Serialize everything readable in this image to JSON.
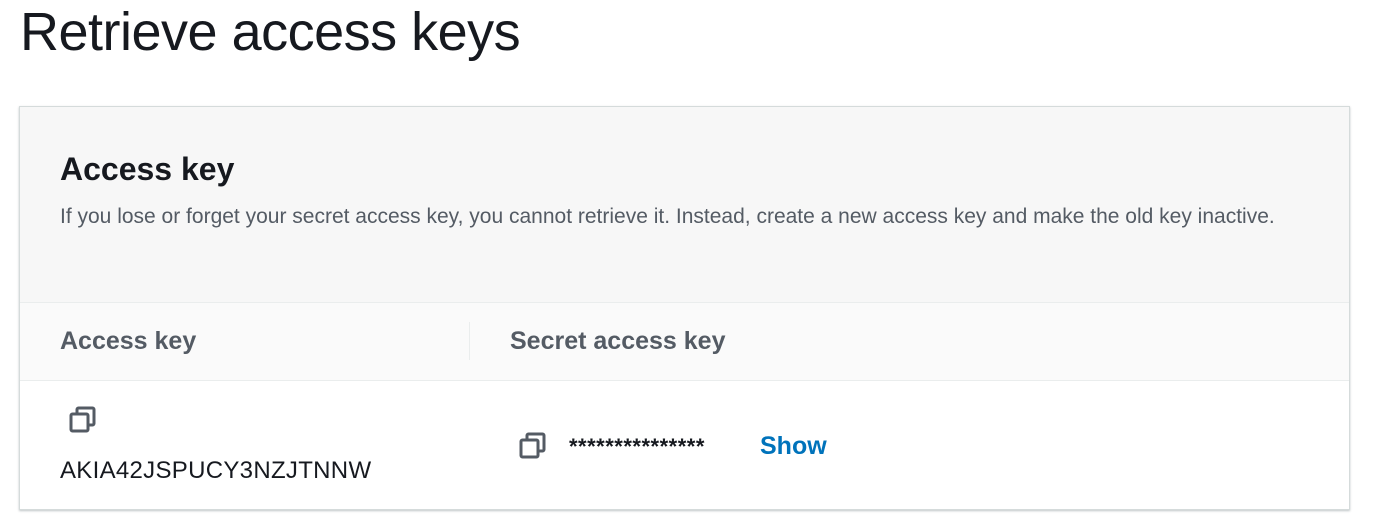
{
  "page": {
    "title": "Retrieve access keys"
  },
  "panel": {
    "title": "Access key",
    "description": "If you lose or forget your secret access key, you cannot retrieve it. Instead, create a new access key and make the old key inactive."
  },
  "table": {
    "columns": [
      "Access key",
      "Secret access key"
    ],
    "row": {
      "access_key": "AKIA42JSPUCY3NZJTNNW",
      "secret_access_key_masked": "***************",
      "show_label": "Show"
    }
  },
  "icons": {
    "copy": "copy-icon"
  },
  "colors": {
    "link": "#0073bb",
    "header_bg": "#f7f7f7",
    "muted_text": "#545b64"
  }
}
